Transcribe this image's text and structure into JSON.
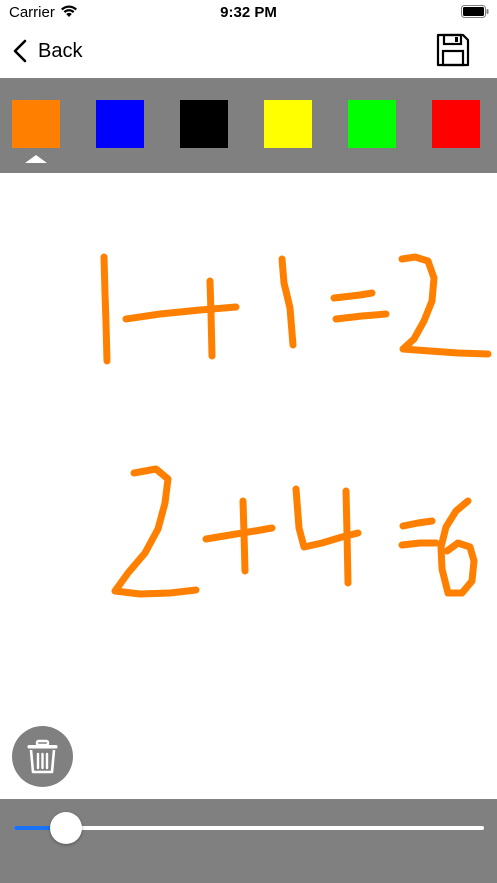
{
  "status_bar": {
    "carrier": "Carrier",
    "time": "9:32 PM",
    "wifi_icon": "wifi-icon",
    "battery_icon": "battery-icon"
  },
  "nav": {
    "back_label": "Back",
    "back_icon": "chevron-left-icon",
    "save_icon": "floppy-disk-icon"
  },
  "palette": {
    "colors": [
      "#ff7f00",
      "#0000ff",
      "#000000",
      "#ffff00",
      "#00ff00",
      "#ff0000"
    ],
    "selected_index": 0
  },
  "canvas": {
    "stroke_color": "#ff8000"
  },
  "trash": {
    "icon": "trash-icon"
  },
  "brush_slider": {
    "value": 0.11
  }
}
